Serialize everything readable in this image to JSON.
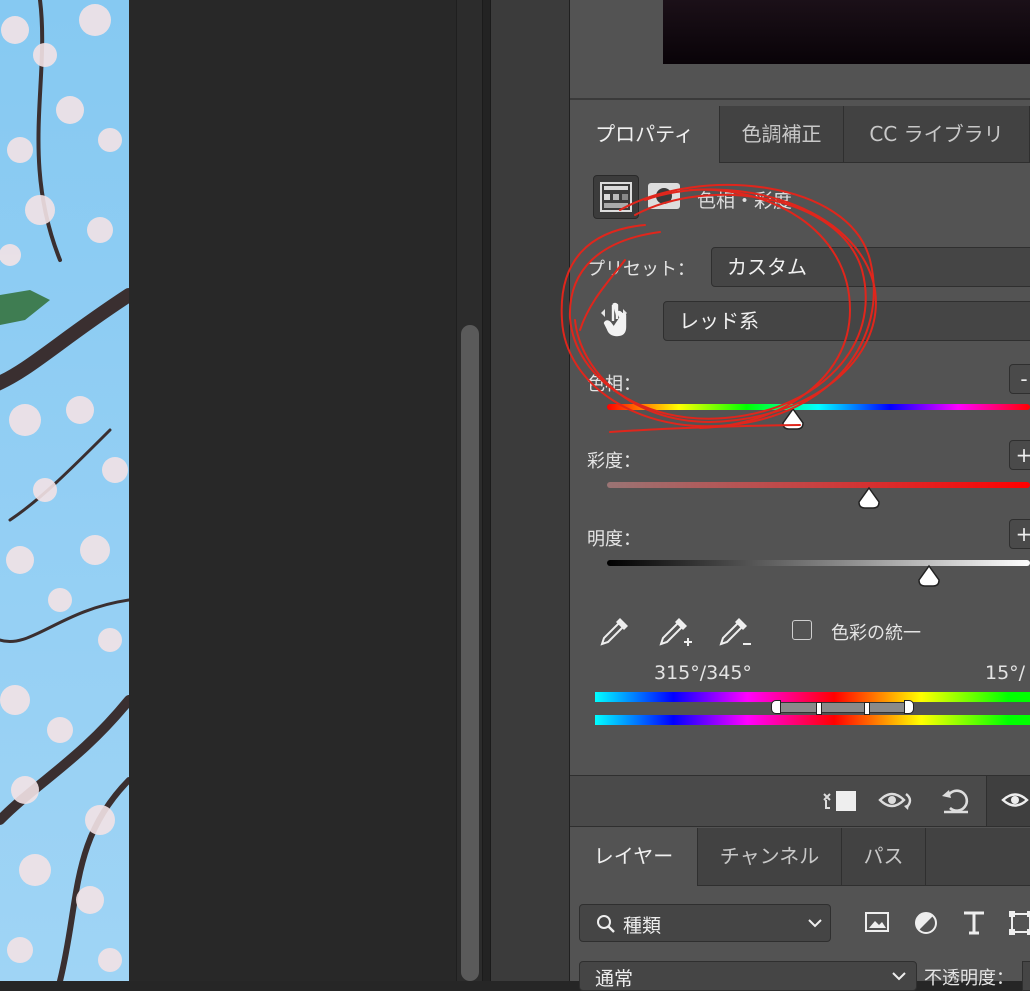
{
  "properties_tabs": [
    {
      "label": "プロパティ",
      "active": true
    },
    {
      "label": "色調補正",
      "active": false
    },
    {
      "label": "CC ライブラリ",
      "active": false
    }
  ],
  "adjustment": {
    "title": "色相・彩度",
    "preset_label": "プリセット：",
    "preset_value": "カスタム",
    "channel_value": "レッド系",
    "hue_label": "色相：",
    "hue_value": 0,
    "saturation_label": "彩度：",
    "saturation_value": 0,
    "lightness_label": "明度：",
    "lightness_value": 0,
    "colorize_label": "色彩の統一",
    "colorize_checked": false,
    "range_left": "315°/345°",
    "range_right": "15°/"
  },
  "footer_icons": [
    "clip-to-layer-icon",
    "view-previous-state-icon",
    "reset-icon",
    "visibility-icon"
  ],
  "layers_tabs": [
    {
      "label": "レイヤー",
      "active": true
    },
    {
      "label": "チャンネル",
      "active": false
    },
    {
      "label": "パス",
      "active": false
    }
  ],
  "layers": {
    "filter_label": "種類",
    "blend_mode": "通常",
    "opacity_label": "不透明度："
  },
  "colors": {
    "panel_bg": "#535353",
    "annotation_red": "#e0261c"
  }
}
